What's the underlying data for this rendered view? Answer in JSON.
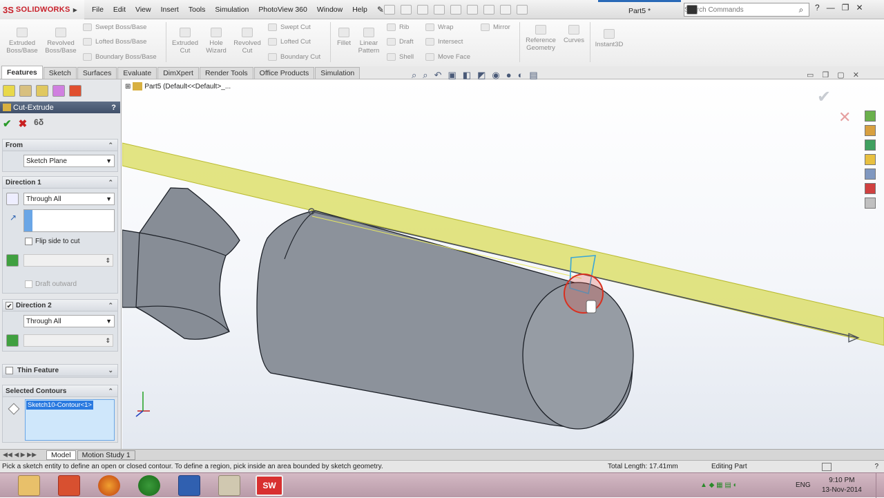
{
  "app": {
    "logo_mark": "3S",
    "logo_text": "SOLIDWORKS",
    "doc_title": "Part5 *"
  },
  "menu": [
    "File",
    "Edit",
    "View",
    "Insert",
    "Tools",
    "Simulation",
    "PhotoView 360",
    "Window",
    "Help"
  ],
  "search": {
    "placeholder": "Search Commands",
    "icon": "search-icon"
  },
  "commands": {
    "extruded_boss": "Extruded Boss/Base",
    "revolved_boss": "Revolved Boss/Base",
    "swept_boss": "Swept Boss/Base",
    "lofted_boss": "Lofted Boss/Base",
    "boundary_boss": "Boundary Boss/Base",
    "extruded_cut": "Extruded Cut",
    "hole_wizard": "Hole Wizard",
    "revolved_cut": "Revolved Cut",
    "swept_cut": "Swept Cut",
    "lofted_cut": "Lofted Cut",
    "boundary_cut": "Boundary Cut",
    "fillet": "Fillet",
    "linear_pattern": "Linear Pattern",
    "rib": "Rib",
    "draft": "Draft",
    "shell": "Shell",
    "wrap": "Wrap",
    "intersect": "Intersect",
    "mirror": "Mirror",
    "move_face": "Move Face",
    "reference_geometry": "Reference Geometry",
    "curves": "Curves",
    "instant3d": "Instant3D"
  },
  "tabs": [
    "Features",
    "Sketch",
    "Surfaces",
    "Evaluate",
    "DimXpert",
    "Render Tools",
    "Office Products",
    "Simulation"
  ],
  "tree": {
    "path": "Part5  (Default<<Default>_..."
  },
  "pm": {
    "title": "Cut-Extrude",
    "help": "?",
    "from": {
      "header": "From",
      "value": "Sketch Plane"
    },
    "dir1": {
      "header": "Direction 1",
      "value": "Through All",
      "flip": "Flip side to cut",
      "draft": "Draft outward"
    },
    "dir2": {
      "header": "Direction 2",
      "value": "Through All"
    },
    "thin": {
      "header": "Thin Feature"
    },
    "contours": {
      "header": "Selected Contours",
      "item": "Sketch10-Contour<1>"
    }
  },
  "bottom_tabs": [
    "Model",
    "Motion Study 1"
  ],
  "status": {
    "message": "Pick a sketch entity to define an open or closed contour. To define a region, pick inside an area bounded by sketch geometry.",
    "length": "Total Length: 17.41mm",
    "mode": "Editing Part"
  },
  "taskbar": {
    "lang": "ENG",
    "time": "9:10 PM",
    "date": "13-Nov-2014",
    "sw_label": "SW"
  },
  "colors": {
    "accent": "#2a6ab8",
    "sw_red": "#c8202a",
    "plane_yellow": "#d9dc5a",
    "part_gray": "#8a9099"
  }
}
